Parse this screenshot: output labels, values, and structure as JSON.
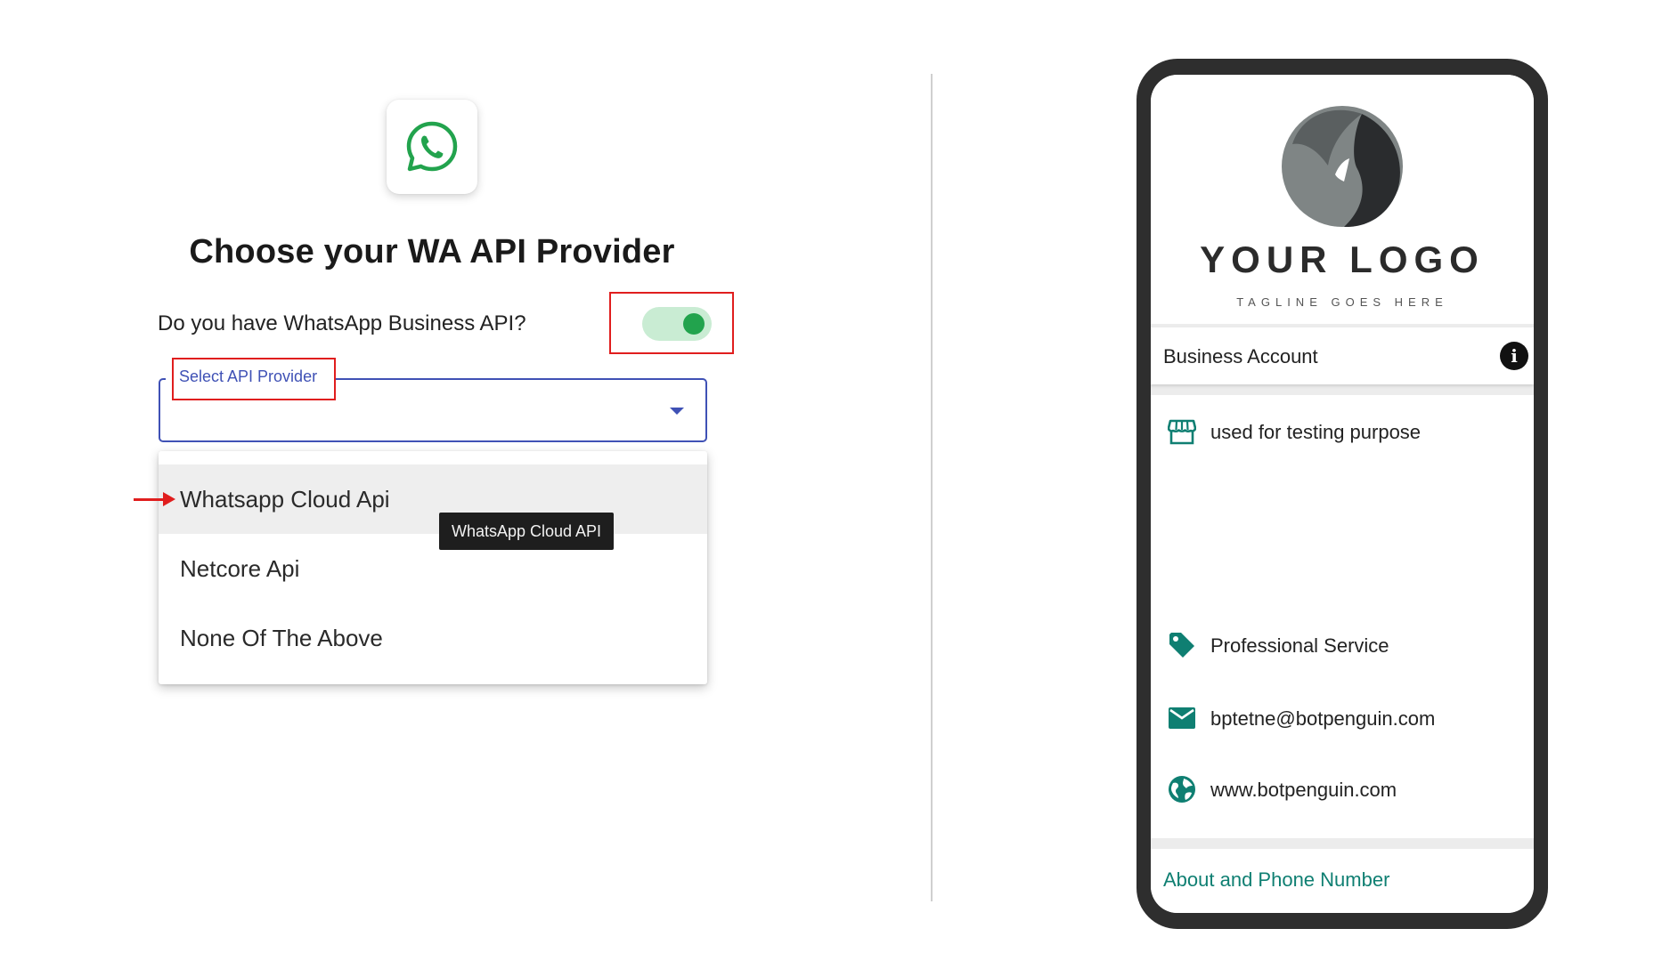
{
  "left_panel": {
    "title": "Choose your WA API Provider",
    "question": "Do you have WhatsApp Business API?",
    "toggle_state": "on",
    "select": {
      "label": "Select API Provider",
      "value": ""
    },
    "dropdown_options": [
      "Whatsapp Cloud Api",
      "Netcore Api",
      "None Of The Above"
    ],
    "tooltip": "WhatsApp Cloud API"
  },
  "phone_preview": {
    "logo_text": "YOUR LOGO",
    "logo_tagline": "TAGLINE GOES HERE",
    "header_title": "Business Account",
    "details": [
      {
        "icon": "store-icon",
        "text": "used for testing purpose"
      },
      {
        "icon": "tag-icon",
        "text": "Professional Service"
      },
      {
        "icon": "email-icon",
        "text": "bptetne@botpenguin.com"
      },
      {
        "icon": "globe-icon",
        "text": "www.botpenguin.com"
      }
    ],
    "footer_link": "About and Phone Number"
  },
  "colors": {
    "whatsapp_green": "#22a34d",
    "accent_blue": "#3f51b5",
    "highlight_red": "#e01e1e",
    "teal": "#0f7f72"
  }
}
